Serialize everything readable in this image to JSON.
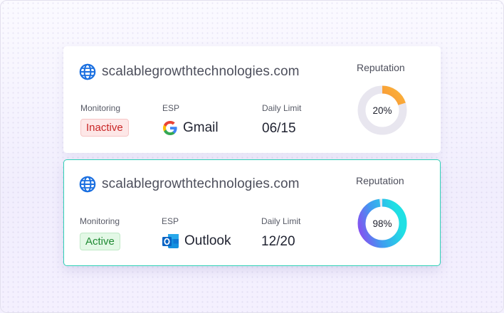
{
  "cards": [
    {
      "domain": "scalablegrowthtechnologies.com",
      "monitoring_label": "Monitoring",
      "monitoring_status": "Inactive",
      "esp_label": "ESP",
      "esp_name": "Gmail",
      "esp_icon": "google-icon",
      "limit_label": "Daily Limit",
      "limit_value": "06/15",
      "reputation_label": "Reputation",
      "reputation_text": "20%",
      "reputation_value": 0.2,
      "colors": {
        "ring_start": "#f2662e",
        "ring_end": "#fbb43a",
        "track": "#e8e6ef",
        "badge_text": "#c92626"
      }
    },
    {
      "domain": "scalablegrowthtechnologies.com",
      "monitoring_label": "Monitoring",
      "monitoring_status": "Active",
      "esp_label": "ESP",
      "esp_name": "Outlook",
      "esp_icon": "outlook-icon",
      "limit_label": "Daily Limit",
      "limit_value": "12/20",
      "reputation_label": "Reputation",
      "reputation_text": "98%",
      "reputation_value": 0.98,
      "colors": {
        "ring_start": "#8a4cf0",
        "ring_end": "#1fe0e4",
        "track": "#e8e6ef",
        "badge_text": "#1f8a33"
      }
    }
  ],
  "colors": {
    "card_border_active": "#2fd0b6",
    "globe": "#1a6fe0"
  }
}
